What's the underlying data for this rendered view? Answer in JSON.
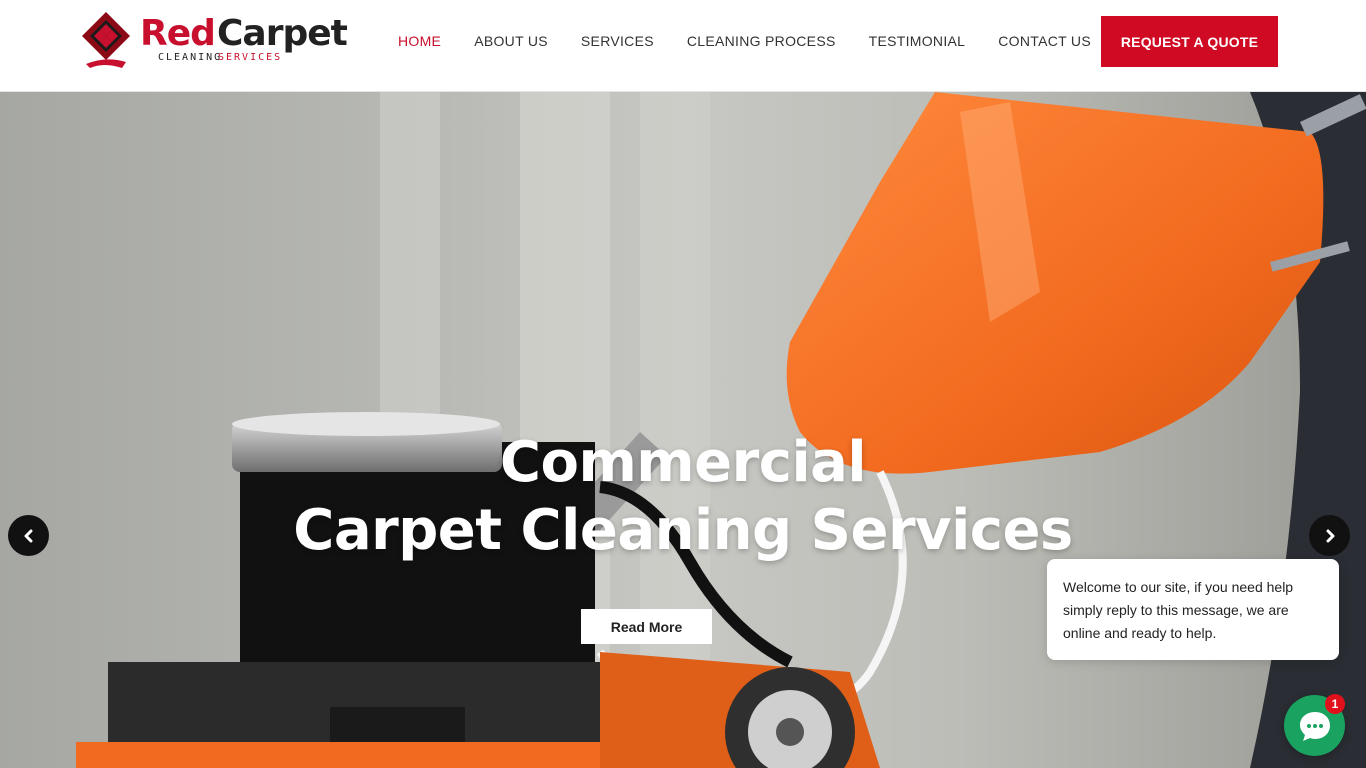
{
  "brand": {
    "name_red": "Red",
    "name_dark": "Carpet",
    "tagline_left": "CLEANING",
    "tagline_right": "SERVICES"
  },
  "nav": {
    "items": [
      {
        "label": "HOME",
        "active": true
      },
      {
        "label": "ABOUT US",
        "active": false
      },
      {
        "label": "SERVICES",
        "active": false
      },
      {
        "label": "CLEANING PROCESS",
        "active": false
      },
      {
        "label": "TESTIMONIAL",
        "active": false
      },
      {
        "label": "CONTACT US",
        "active": false
      }
    ],
    "cta_label": "REQUEST A QUOTE"
  },
  "hero": {
    "title_line1": "Commercial",
    "title_line2": "Carpet Cleaning Services",
    "button_label": "Read More",
    "prev_icon": "chevron-left-icon",
    "next_icon": "chevron-right-icon"
  },
  "chat": {
    "message": "Welcome to our site, if you need help simply reply to this message, we are online and ready to help.",
    "unread_count": "1",
    "icon": "chat-icon"
  },
  "colors": {
    "accent": "#c8102e",
    "cta": "#d10a24",
    "chat": "#1aa260",
    "machine_orange": "#f26a1f"
  }
}
